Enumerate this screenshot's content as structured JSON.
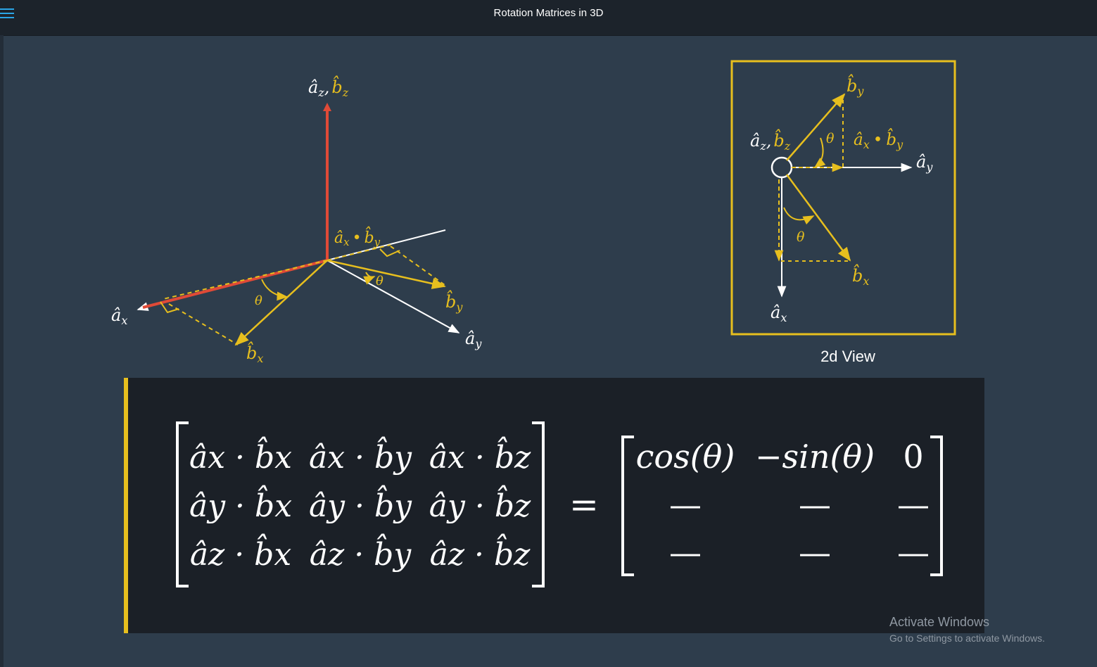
{
  "app": {
    "title": "Rotation Matrices in 3D",
    "menu_icon": "hamburger-menu-icon"
  },
  "colors": {
    "background": "#2e3d4c",
    "topbar": "#1c232b",
    "accent_yellow": "#e7bf1e",
    "axis_red": "#e04a37",
    "line_white": "#ffffff",
    "menu_blue": "#2aa5e6",
    "panel_dark": "#1b2027"
  },
  "diagram3d": {
    "label_az_bz_a": "â",
    "label_az_bz_a_sub": "z",
    "label_az_bz_comma": ",",
    "label_az_bz_b": "b̂",
    "label_az_bz_b_sub": "z",
    "label_ax": "â",
    "label_ax_sub": "x",
    "label_ay": "â",
    "label_ay_sub": "y",
    "label_bx": "b̂",
    "label_bx_sub": "x",
    "label_by": "b̂",
    "label_by_sub": "y",
    "dot_product_a": "â",
    "dot_product_a_sub": "x",
    "dot_product_op": "•",
    "dot_product_b": "b̂",
    "dot_product_b_sub": "y",
    "theta_1": "θ",
    "theta_2": "θ"
  },
  "diagram2d": {
    "caption": "2d View",
    "label_az_bz_a": "â",
    "label_az_bz_a_sub": "z",
    "label_az_bz_comma": ",",
    "label_az_bz_b": "b̂",
    "label_az_bz_b_sub": "z",
    "label_ax": "â",
    "label_ax_sub": "x",
    "label_ay": "â",
    "label_ay_sub": "y",
    "label_bx": "b̂",
    "label_bx_sub": "x",
    "label_by": "b̂",
    "label_by_sub": "y",
    "dot_product_a": "â",
    "dot_product_a_sub": "x",
    "dot_product_op": "•",
    "dot_product_b": "b̂",
    "dot_product_b_sub": "y",
    "theta_1": "θ",
    "theta_2": "θ"
  },
  "equation": {
    "lhs_rows": [
      [
        "âx · b̂x",
        "âx · b̂y",
        "âx · b̂z"
      ],
      [
        "ây · b̂x",
        "ây · b̂y",
        "ây · b̂z"
      ],
      [
        "âz · b̂x",
        "âz · b̂y",
        "âz · b̂z"
      ]
    ],
    "equals": "=",
    "rhs_rows": [
      [
        "cos(θ)",
        "−sin(θ)",
        "0"
      ],
      [
        "—",
        "—",
        "—"
      ],
      [
        "—",
        "—",
        "—"
      ]
    ]
  },
  "watermark": {
    "line1": "Activate Windows",
    "line2": "Go to Settings to activate Windows."
  }
}
